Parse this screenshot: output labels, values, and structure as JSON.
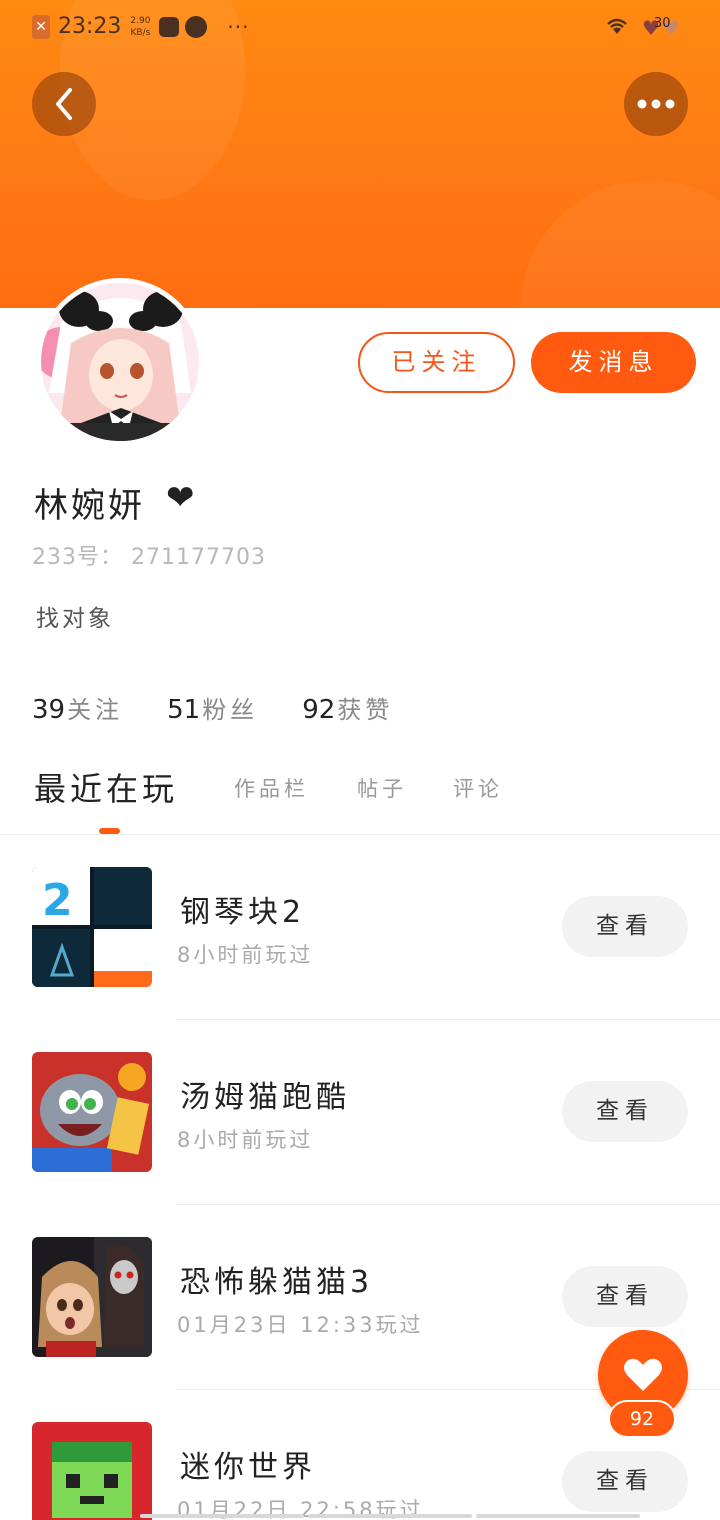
{
  "status_bar": {
    "time": "23:23",
    "speed": "2.90 KB/s",
    "dots": "···",
    "battery": "30"
  },
  "header": {
    "back_icon": "chevron-left-icon",
    "more_icon": "ellipsis-icon"
  },
  "profile": {
    "name": "林婉妍",
    "name_suffix": "❤",
    "uid": "233号： 271177703",
    "bio": "找对象",
    "follow_label": "已关注",
    "message_label": "发消息",
    "stats": [
      {
        "num": "39",
        "label": "关注"
      },
      {
        "num": "51",
        "label": "粉丝"
      },
      {
        "num": "92",
        "label": "获赞"
      }
    ]
  },
  "tabs": [
    {
      "label": "最近在玩"
    },
    {
      "label": "作品栏"
    },
    {
      "label": "帖子"
    },
    {
      "label": "评论"
    }
  ],
  "games": [
    {
      "title": "钢琴块2",
      "meta": "8小时前玩过",
      "action": "查看"
    },
    {
      "title": "汤姆猫跑酷",
      "meta": "8小时前玩过",
      "action": "查看"
    },
    {
      "title": "恐怖躲猫猫3",
      "meta": "01月23日 12:33玩过",
      "action": "查看"
    },
    {
      "title": "迷你世界",
      "meta": "01月22日 22:58玩过",
      "action": "查看"
    }
  ],
  "like_fab": {
    "icon": "heart-icon",
    "count": "92"
  },
  "colors": {
    "accent": "#ff5a10",
    "banner": "#ff7a14"
  }
}
